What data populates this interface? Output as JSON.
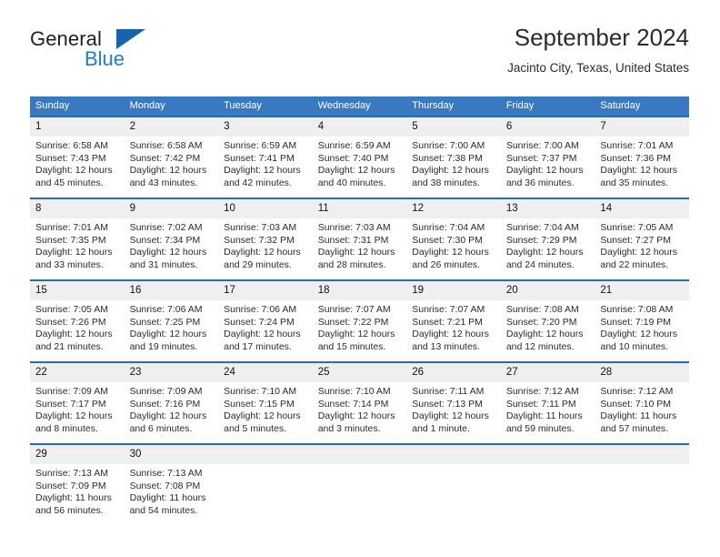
{
  "brand": {
    "name_top": "General",
    "name_bottom": "Blue",
    "triangle_icon": "blue-triangle-logo-mark",
    "colors": {
      "general_text": "#231f20",
      "blue_text": "#1a7fd4",
      "triangle": "#1565ad"
    }
  },
  "header": {
    "title": "September 2024",
    "subtitle": "Jacinto City, Texas, United States"
  },
  "calendar": {
    "colors": {
      "header_bg": "#3a79bf",
      "header_text": "#ffffff",
      "row_divider": "#2c6bb0",
      "daynum_bg": "#efefef"
    },
    "weekdays": [
      "Sunday",
      "Monday",
      "Tuesday",
      "Wednesday",
      "Thursday",
      "Friday",
      "Saturday"
    ],
    "weeks": [
      [
        {
          "day": "1",
          "sunrise": "Sunrise: 6:58 AM",
          "sunset": "Sunset: 7:43 PM",
          "daylight_line1": "Daylight: 12 hours",
          "daylight_line2": "and 45 minutes."
        },
        {
          "day": "2",
          "sunrise": "Sunrise: 6:58 AM",
          "sunset": "Sunset: 7:42 PM",
          "daylight_line1": "Daylight: 12 hours",
          "daylight_line2": "and 43 minutes."
        },
        {
          "day": "3",
          "sunrise": "Sunrise: 6:59 AM",
          "sunset": "Sunset: 7:41 PM",
          "daylight_line1": "Daylight: 12 hours",
          "daylight_line2": "and 42 minutes."
        },
        {
          "day": "4",
          "sunrise": "Sunrise: 6:59 AM",
          "sunset": "Sunset: 7:40 PM",
          "daylight_line1": "Daylight: 12 hours",
          "daylight_line2": "and 40 minutes."
        },
        {
          "day": "5",
          "sunrise": "Sunrise: 7:00 AM",
          "sunset": "Sunset: 7:38 PM",
          "daylight_line1": "Daylight: 12 hours",
          "daylight_line2": "and 38 minutes."
        },
        {
          "day": "6",
          "sunrise": "Sunrise: 7:00 AM",
          "sunset": "Sunset: 7:37 PM",
          "daylight_line1": "Daylight: 12 hours",
          "daylight_line2": "and 36 minutes."
        },
        {
          "day": "7",
          "sunrise": "Sunrise: 7:01 AM",
          "sunset": "Sunset: 7:36 PM",
          "daylight_line1": "Daylight: 12 hours",
          "daylight_line2": "and 35 minutes."
        }
      ],
      [
        {
          "day": "8",
          "sunrise": "Sunrise: 7:01 AM",
          "sunset": "Sunset: 7:35 PM",
          "daylight_line1": "Daylight: 12 hours",
          "daylight_line2": "and 33 minutes."
        },
        {
          "day": "9",
          "sunrise": "Sunrise: 7:02 AM",
          "sunset": "Sunset: 7:34 PM",
          "daylight_line1": "Daylight: 12 hours",
          "daylight_line2": "and 31 minutes."
        },
        {
          "day": "10",
          "sunrise": "Sunrise: 7:03 AM",
          "sunset": "Sunset: 7:32 PM",
          "daylight_line1": "Daylight: 12 hours",
          "daylight_line2": "and 29 minutes."
        },
        {
          "day": "11",
          "sunrise": "Sunrise: 7:03 AM",
          "sunset": "Sunset: 7:31 PM",
          "daylight_line1": "Daylight: 12 hours",
          "daylight_line2": "and 28 minutes."
        },
        {
          "day": "12",
          "sunrise": "Sunrise: 7:04 AM",
          "sunset": "Sunset: 7:30 PM",
          "daylight_line1": "Daylight: 12 hours",
          "daylight_line2": "and 26 minutes."
        },
        {
          "day": "13",
          "sunrise": "Sunrise: 7:04 AM",
          "sunset": "Sunset: 7:29 PM",
          "daylight_line1": "Daylight: 12 hours",
          "daylight_line2": "and 24 minutes."
        },
        {
          "day": "14",
          "sunrise": "Sunrise: 7:05 AM",
          "sunset": "Sunset: 7:27 PM",
          "daylight_line1": "Daylight: 12 hours",
          "daylight_line2": "and 22 minutes."
        }
      ],
      [
        {
          "day": "15",
          "sunrise": "Sunrise: 7:05 AM",
          "sunset": "Sunset: 7:26 PM",
          "daylight_line1": "Daylight: 12 hours",
          "daylight_line2": "and 21 minutes."
        },
        {
          "day": "16",
          "sunrise": "Sunrise: 7:06 AM",
          "sunset": "Sunset: 7:25 PM",
          "daylight_line1": "Daylight: 12 hours",
          "daylight_line2": "and 19 minutes."
        },
        {
          "day": "17",
          "sunrise": "Sunrise: 7:06 AM",
          "sunset": "Sunset: 7:24 PM",
          "daylight_line1": "Daylight: 12 hours",
          "daylight_line2": "and 17 minutes."
        },
        {
          "day": "18",
          "sunrise": "Sunrise: 7:07 AM",
          "sunset": "Sunset: 7:22 PM",
          "daylight_line1": "Daylight: 12 hours",
          "daylight_line2": "and 15 minutes."
        },
        {
          "day": "19",
          "sunrise": "Sunrise: 7:07 AM",
          "sunset": "Sunset: 7:21 PM",
          "daylight_line1": "Daylight: 12 hours",
          "daylight_line2": "and 13 minutes."
        },
        {
          "day": "20",
          "sunrise": "Sunrise: 7:08 AM",
          "sunset": "Sunset: 7:20 PM",
          "daylight_line1": "Daylight: 12 hours",
          "daylight_line2": "and 12 minutes."
        },
        {
          "day": "21",
          "sunrise": "Sunrise: 7:08 AM",
          "sunset": "Sunset: 7:19 PM",
          "daylight_line1": "Daylight: 12 hours",
          "daylight_line2": "and 10 minutes."
        }
      ],
      [
        {
          "day": "22",
          "sunrise": "Sunrise: 7:09 AM",
          "sunset": "Sunset: 7:17 PM",
          "daylight_line1": "Daylight: 12 hours",
          "daylight_line2": "and 8 minutes."
        },
        {
          "day": "23",
          "sunrise": "Sunrise: 7:09 AM",
          "sunset": "Sunset: 7:16 PM",
          "daylight_line1": "Daylight: 12 hours",
          "daylight_line2": "and 6 minutes."
        },
        {
          "day": "24",
          "sunrise": "Sunrise: 7:10 AM",
          "sunset": "Sunset: 7:15 PM",
          "daylight_line1": "Daylight: 12 hours",
          "daylight_line2": "and 5 minutes."
        },
        {
          "day": "25",
          "sunrise": "Sunrise: 7:10 AM",
          "sunset": "Sunset: 7:14 PM",
          "daylight_line1": "Daylight: 12 hours",
          "daylight_line2": "and 3 minutes."
        },
        {
          "day": "26",
          "sunrise": "Sunrise: 7:11 AM",
          "sunset": "Sunset: 7:13 PM",
          "daylight_line1": "Daylight: 12 hours",
          "daylight_line2": "and 1 minute."
        },
        {
          "day": "27",
          "sunrise": "Sunrise: 7:12 AM",
          "sunset": "Sunset: 7:11 PM",
          "daylight_line1": "Daylight: 11 hours",
          "daylight_line2": "and 59 minutes."
        },
        {
          "day": "28",
          "sunrise": "Sunrise: 7:12 AM",
          "sunset": "Sunset: 7:10 PM",
          "daylight_line1": "Daylight: 11 hours",
          "daylight_line2": "and 57 minutes."
        }
      ],
      [
        {
          "day": "29",
          "sunrise": "Sunrise: 7:13 AM",
          "sunset": "Sunset: 7:09 PM",
          "daylight_line1": "Daylight: 11 hours",
          "daylight_line2": "and 56 minutes."
        },
        {
          "day": "30",
          "sunrise": "Sunrise: 7:13 AM",
          "sunset": "Sunset: 7:08 PM",
          "daylight_line1": "Daylight: 11 hours",
          "daylight_line2": "and 54 minutes."
        },
        {
          "day": "",
          "sunrise": "",
          "sunset": "",
          "daylight_line1": "",
          "daylight_line2": ""
        },
        {
          "day": "",
          "sunrise": "",
          "sunset": "",
          "daylight_line1": "",
          "daylight_line2": ""
        },
        {
          "day": "",
          "sunrise": "",
          "sunset": "",
          "daylight_line1": "",
          "daylight_line2": ""
        },
        {
          "day": "",
          "sunrise": "",
          "sunset": "",
          "daylight_line1": "",
          "daylight_line2": ""
        },
        {
          "day": "",
          "sunrise": "",
          "sunset": "",
          "daylight_line1": "",
          "daylight_line2": ""
        }
      ]
    ]
  }
}
